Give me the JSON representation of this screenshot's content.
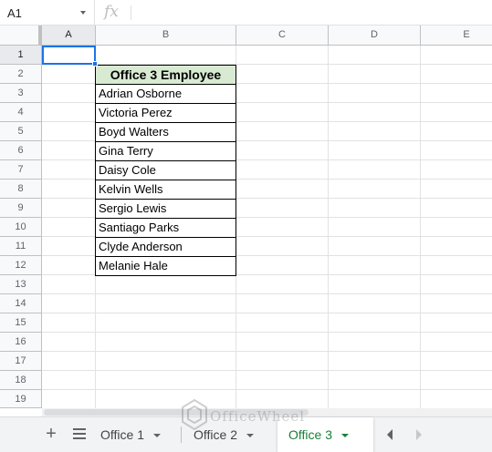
{
  "formula_bar": {
    "name_box": "A1",
    "fx_symbol": "fx",
    "formula": ""
  },
  "columns": [
    "A",
    "B",
    "C",
    "D",
    "E"
  ],
  "rows": [
    "1",
    "2",
    "3",
    "4",
    "5",
    "6",
    "7",
    "8",
    "9",
    "10",
    "11",
    "12",
    "13",
    "14",
    "15",
    "16",
    "17",
    "18",
    "19"
  ],
  "selected_cell": "A1",
  "table": {
    "header": "Office 3 Employee",
    "header_color": "#d9ead3",
    "employees": [
      "Adrian Osborne",
      "Victoria Perez",
      "Boyd Walters",
      "Gina Terry",
      "Daisy Cole",
      "Kelvin Wells",
      "Sergio Lewis",
      "Santiago Parks",
      "Clyde Anderson",
      "Melanie Hale"
    ]
  },
  "sheet_tabs": {
    "add_icon": "+",
    "tabs": [
      "Office 1",
      "Office 2",
      "Office 3"
    ],
    "active_tab": "Office 3",
    "active_color": "#188038"
  },
  "watermark": {
    "text": "OfficeWheel"
  },
  "colors": {
    "selection": "#1a73e8",
    "header_bg": "#f8f9fa"
  }
}
